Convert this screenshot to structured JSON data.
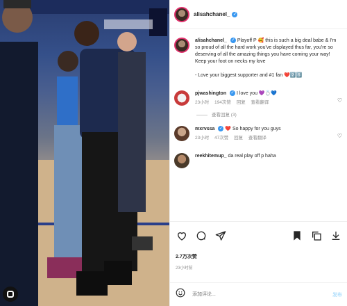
{
  "header": {
    "username": "alisahchanel_"
  },
  "caption": {
    "username": "alisahchanel_",
    "text": "Playoff P 🥰 this is such a big deal babe & I'm so proud of all the hard work you've displayed thus far, you're so deserving of all the amazing things you have coming your way! Keep your foot on necks my love",
    "signoff": "- Love your biggest supporter and #1 fan ❤️2️⃣5️⃣"
  },
  "comments": [
    {
      "username": "pjwashington",
      "text": "I love you 💜💍💙",
      "time": "23小时",
      "likes": "194次赞",
      "reply": "回复",
      "translate": "查看翻译",
      "replies": "查看回复 (3)"
    },
    {
      "username": "mxrvssa",
      "text": "❤️ So happy for you guys",
      "time": "23小时",
      "likes": "47次赞",
      "reply": "回复",
      "translate": "查看翻译"
    },
    {
      "username": "reekhitemup_",
      "text": "da real play off p haha"
    }
  ],
  "stats": {
    "likes": "2.7万次赞",
    "date": "23小时前"
  },
  "add_comment": {
    "placeholder": "添加评论...",
    "post_label": "发布"
  },
  "icons": [
    "heart-icon",
    "comment-icon",
    "share-icon",
    "bookmark-icon",
    "copy-icon",
    "download-icon",
    "emoji-icon"
  ]
}
